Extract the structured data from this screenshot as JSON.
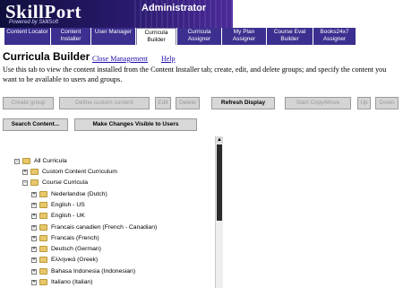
{
  "header": {
    "logo": "SkillPort",
    "logo_sub": "Powered by SkillSoft",
    "role": "Administrator"
  },
  "tabs": [
    {
      "label": "Content Locator"
    },
    {
      "label": "Content Installer"
    },
    {
      "label": "User Manager"
    },
    {
      "label": "Curricula Builder"
    },
    {
      "label": "Curricula Assigner"
    },
    {
      "label": "My Plan Assigner"
    },
    {
      "label": "Course Eval Builder"
    },
    {
      "label": "Books24x7 Assigner"
    }
  ],
  "page": {
    "title": "Curricula Builder",
    "close_link": "Close Management",
    "help_link": "Help",
    "description": "Use this tab to view the content installed from the Content Installer tab; create, edit, and delete groups; and specify the content you want to be available to users and groups."
  },
  "toolbar": {
    "create_group": "Create group",
    "define_custom": "Define custom content",
    "edit": "Edit",
    "delete": "Delete",
    "refresh": "Refresh Display",
    "start_copy": "Start Copy/Move",
    "up": "Up",
    "down": "Down",
    "search": "Search Content...",
    "make_visible": "Make Changes Visible to Users"
  },
  "tree": {
    "root": "All Curricula",
    "items": [
      {
        "label": "Custom Content Curriculum",
        "level": 1,
        "expander": "+"
      },
      {
        "label": "Course Curricula",
        "level": 1,
        "expander": "-"
      },
      {
        "label": "Nederlandse (Dutch)",
        "level": 2,
        "expander": "+"
      },
      {
        "label": "English - US",
        "level": 2,
        "expander": "+"
      },
      {
        "label": "English - UK",
        "level": 2,
        "expander": "+"
      },
      {
        "label": "Francais canadien (French - Canadian)",
        "level": 2,
        "expander": "+"
      },
      {
        "label": "Francais (French)",
        "level": 2,
        "expander": "+"
      },
      {
        "label": "Deutsch (German)",
        "level": 2,
        "expander": "+"
      },
      {
        "label": "Ελληνικά (Greek)",
        "level": 2,
        "expander": "+"
      },
      {
        "label": "Bahasa Indonesia (Indonesian)",
        "level": 2,
        "expander": "+"
      },
      {
        "label": "Italiano (Italian)",
        "level": 2,
        "expander": "+"
      }
    ]
  },
  "colors": {
    "tab_bg": "#3b2f8f",
    "banner_dark": "#0f0f3d",
    "link": "#1a0dab"
  }
}
